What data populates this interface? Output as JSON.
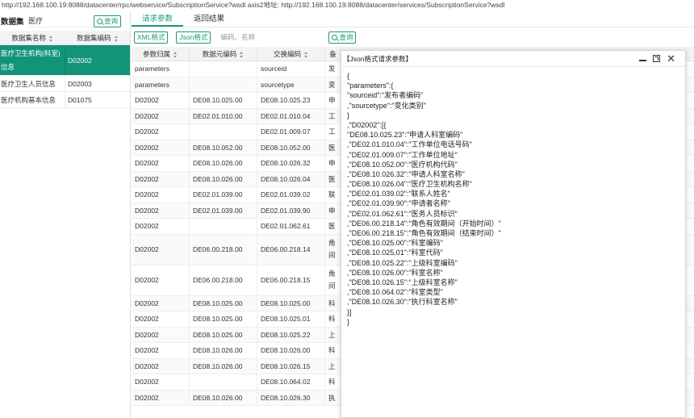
{
  "top_url": "http://192.168.100.19:8088/datacenter/rpc/webservice/SubscriptionService?wsdl  axis2地址: http://192.168.100.19:8088/datacenter/services/SubscriptionService?wsdl",
  "left": {
    "search_label": "数据集",
    "search_value": "医疗",
    "query_label": "查询",
    "columns": [
      "数据集名称",
      "数据集编码"
    ],
    "rows": [
      {
        "name": "医疗卫生机构(科室)信息",
        "code": "D02002",
        "selected": true
      },
      {
        "name": "医疗卫生人员信息",
        "code": "D02003",
        "selected": false
      },
      {
        "name": "医疗机构基本信息",
        "code": "D01075",
        "selected": false
      }
    ]
  },
  "right": {
    "tabs": [
      "请求参数",
      "返回结果"
    ],
    "active_tab": 0,
    "xml_btn": "XML格式",
    "json_btn": "Json格式",
    "filter_placeholder": "编码、名称",
    "query_label": "查询",
    "columns": [
      "参数归属",
      "数据元编码",
      "交换编码",
      "备"
    ],
    "rows": [
      [
        "parameters",
        "",
        "sourceid",
        "发"
      ],
      [
        "parameters",
        "",
        "sourcetype",
        "变"
      ],
      [
        "D02002",
        "DE08.10.025.00",
        "DE08.10.025.23",
        "申"
      ],
      [
        "D02002",
        "DE02.01.010.00",
        "DE02.01.010.04",
        "工"
      ],
      [
        "D02002",
        "",
        "DE02.01.009.07",
        "工"
      ],
      [
        "D02002",
        "DE08.10.052.00",
        "DE08.10.052.00",
        "医"
      ],
      [
        "D02002",
        "DE08.10.026.00",
        "DE08.10.026.32",
        "申"
      ],
      [
        "D02002",
        "DE08.10.026.00",
        "DE08.10.026.04",
        "医"
      ],
      [
        "D02002",
        "DE02.01.039.00",
        "DE02.01.039.02",
        "联"
      ],
      [
        "D02002",
        "DE02.01.039.00",
        "DE02.01.039.90",
        "申"
      ],
      [
        "D02002",
        "",
        "DE02.01.062.61",
        "医"
      ],
      [
        "D02002",
        "DE06.00.218.00",
        "DE06.00.218.14",
        "角\n间"
      ],
      [
        "D02002",
        "DE06.00.218.00",
        "DE06.00.218.15",
        "角\n间"
      ],
      [
        "D02002",
        "DE08.10.025.00",
        "DE08.10.025.00",
        "科"
      ],
      [
        "D02002",
        "DE08.10.025.00",
        "DE08.10.025.01",
        "科"
      ],
      [
        "D02002",
        "DE08.10.025.00",
        "DE08.10.025.22",
        "上"
      ],
      [
        "D02002",
        "DE08.10.026.00",
        "DE08.10.026.00",
        "科"
      ],
      [
        "D02002",
        "DE08.10.026.00",
        "DE08.10.026.15",
        "上"
      ],
      [
        "D02002",
        "",
        "DE08.10.064.02",
        "科"
      ],
      [
        "D02002",
        "DE08.10.026.00",
        "DE08.10.026.30",
        "执"
      ]
    ]
  },
  "modal": {
    "title": "【Json格式请求参数】",
    "lines": [
      "{",
      "\"parameters\":{",
      "\"sourceid\":\"发布者编码\"",
      ",\"sourcetype\":\"变化类别\"",
      "}",
      ",\"D02002\":[{",
      "\"DE08.10.025.23\":\"申请人科室编码\"",
      ",\"DE02.01.010.04\":\"工作单位电话号码\"",
      ",\"DE02.01.009.07\":\"工作单位地址\"",
      ",\"DE08.10.052.00\":\"医疗机构代码\"",
      ",\"DE08.10.026.32\":\"申请人科室名称\"",
      ",\"DE08.10.026.04\":\"医疗卫生机构名称\"",
      ",\"DE02.01.039.02\":\"联系人姓名\"",
      ",\"DE02.01.039.90\":\"申请者名称\"",
      ",\"DE02.01.062.61\":\"医务人员标识\"",
      ",\"DE06.00.218.14\":\"角色有效期间（开始时间）\"",
      ",\"DE06.00.218.15\":\"角色有效期间（结束时间）\"",
      ",\"DE08.10.025.00\":\"科室编码\"",
      ",\"DE08.10.025.01\":\"科室代码\"",
      ",\"DE08.10.025.22\":\"上级科室编码\"",
      ",\"DE08.10.026.00\":\"科室名称\"",
      ",\"DE08.10.026.15\":\"上级科室名称\"",
      ",\"DE08.10.064.02\":\"科室类型\"",
      ",\"DE08.10.026.30\":\"执行科室名称\"",
      "}]",
      "}"
    ]
  },
  "colors": {
    "accent": "#1a9a7a",
    "selected_row": "#11947a"
  }
}
